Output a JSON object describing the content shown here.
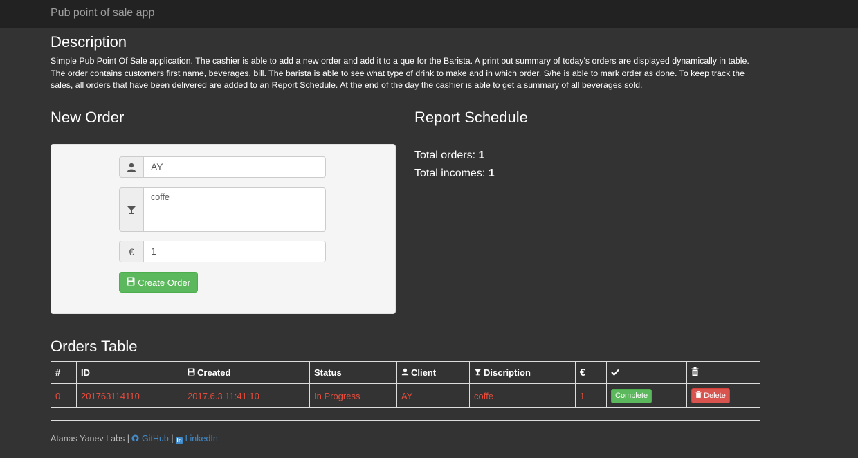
{
  "app": {
    "title": "Pub point of sale app"
  },
  "description": {
    "heading": "Description",
    "text": "Simple Pub Point Of Sale application. The cashier is able to add a new order and add it to a que for the Barista. A print out summary of today's orders are displayed dynamically in table. The order contains customers first name, beverages, bill. The barista is able to see what type of drink to make and in which order. S/he is able to mark order as done. To keep track the sales, all orders that have been delivered are added to an Report Schedule. At the end of the day the cashier is able to get a summary of all beverages sold."
  },
  "new_order": {
    "heading": "New Order",
    "name_value": "AY",
    "beverage_value": "coffe",
    "bill_value": "1",
    "bill_icon": "€",
    "create_label": "Create Order",
    "icons": {
      "name": "user-icon",
      "beverage": "cocktail-glass-icon",
      "bill": "euro-icon",
      "create": "floppy-disk-icon"
    }
  },
  "report": {
    "heading": "Report Schedule",
    "orders_label": "Total orders:",
    "orders_value": "1",
    "incomes_label": "Total incomes:",
    "incomes_value": "1"
  },
  "orders_table": {
    "heading": "Orders Table",
    "columns": {
      "num": "#",
      "id": "ID",
      "created": "Created",
      "status": "Status",
      "client": "Client",
      "description": "Discription",
      "bill": "€"
    },
    "rows": [
      {
        "num": "0",
        "id": "201763114110",
        "created": "2017.6.3 11:41:10",
        "status": "In Progress",
        "client": "AY",
        "description": "coffe",
        "bill": "1",
        "complete_label": "Complete",
        "delete_label": "Delete"
      }
    ]
  },
  "footer": {
    "author": "Atanas Yanev Labs |",
    "github": "GitHub",
    "separator": "|",
    "linkedin": "LinkedIn"
  },
  "colors": {
    "background": "#333333",
    "navbar": "#222222",
    "success": "#5cb85c",
    "danger": "#d9534f",
    "row_text": "#e74c3c",
    "link": "#428bca"
  }
}
